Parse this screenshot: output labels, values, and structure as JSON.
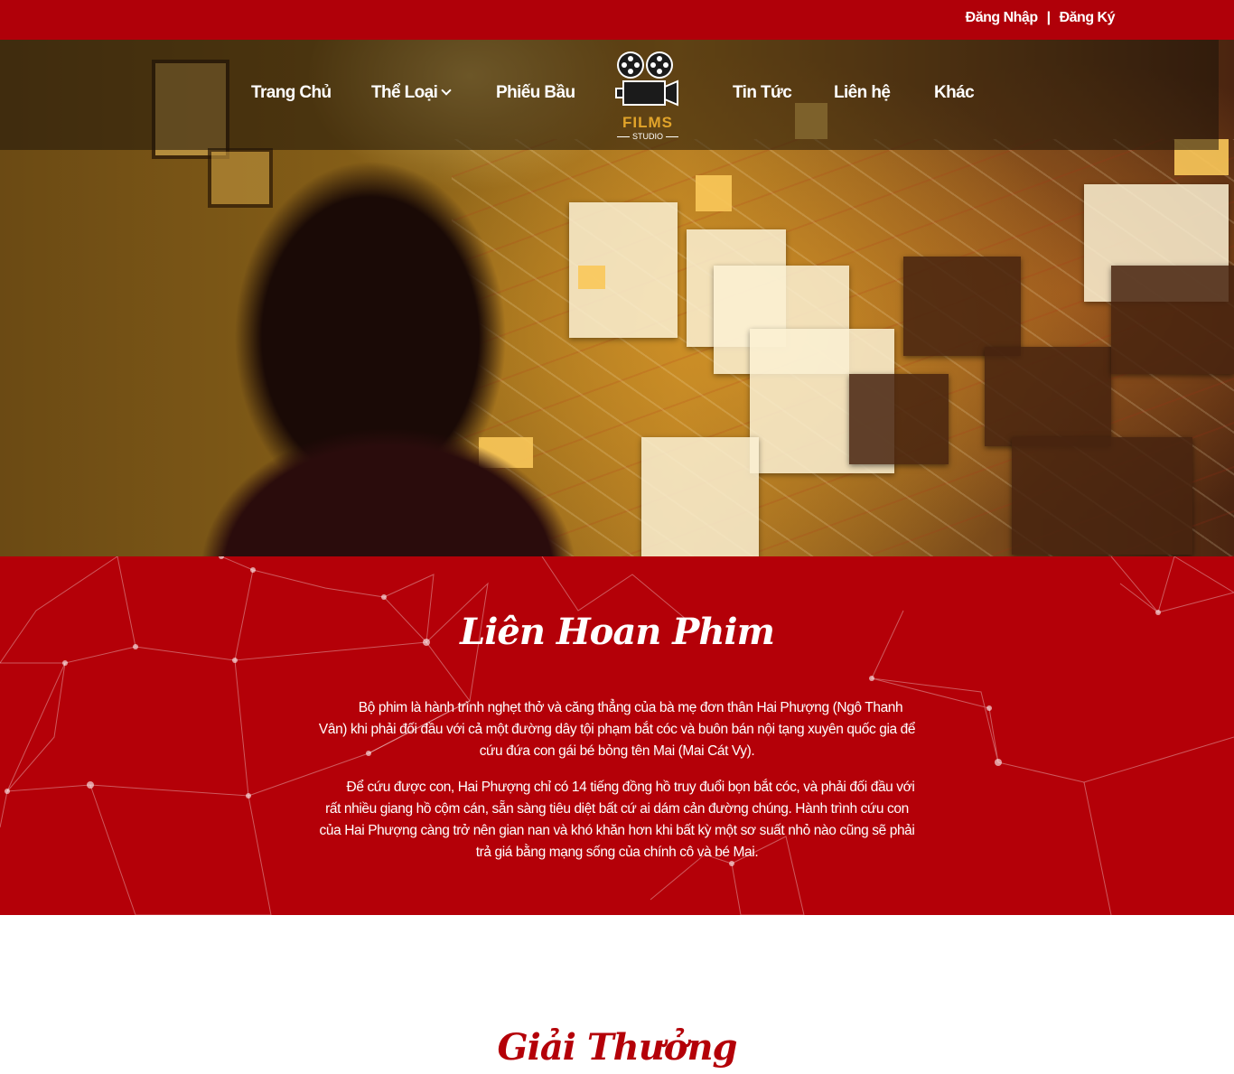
{
  "auth": {
    "login": "Đăng Nhập",
    "separator": "|",
    "register": "Đăng Ký"
  },
  "nav": {
    "home": "Trang Chủ",
    "genre": "Thể Loại",
    "vote": "Phiếu Bầu",
    "news": "Tin Tức",
    "contact": "Liên hệ",
    "other": "Khác"
  },
  "logo": {
    "title": "FILMS",
    "subtitle": "STUDIO",
    "icon": "film-projector-icon"
  },
  "festival": {
    "title": "Liên Hoan Phim",
    "paragraph1": "Bộ phim là hành trình nghẹt thở và căng thẳng của bà mẹ đơn thân Hai Phượng (Ngô Thanh Vân) khi phải đối đầu với cả một đường dây tội phạm bắt cóc và buôn bán nội tạng xuyên quốc gia để cứu đứa con gái bé bỏng tên Mai (Mai Cát Vy).",
    "paragraph2": "Để cứu được con, Hai Phượng chỉ có 14 tiếng đồng hồ truy đuổi bọn bắt cóc, và phải đối đầu với rất nhiều giang hồ cộm cán, sẵn sàng tiêu diệt bất cứ ai dám cản đường chúng. Hành trình cứu con của Hai Phượng càng trở nên gian nan và khó khăn hơn khi bất kỳ một sơ suất nhỏ nào cũng sẽ phải trả giá bằng mạng sống của chính cô và bé Mai."
  },
  "awards": {
    "title": "Giải Thưởng"
  },
  "colors": {
    "brand_red": "#b00009",
    "logo_gold": "#e2a42a"
  }
}
